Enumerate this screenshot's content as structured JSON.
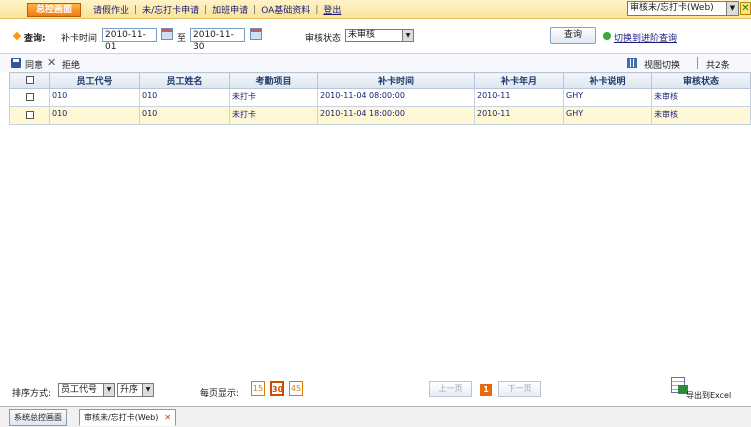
{
  "topbar": {
    "home_label": "总控画面",
    "menu": [
      "请假作业",
      "未/忘打卡申请",
      "加班申请",
      "OA基础资料",
      "登出"
    ],
    "window_select": "审核未/忘打卡(Web)"
  },
  "query": {
    "title": "查询:",
    "time_label": "补卡时间",
    "date_from": "2010-11-01",
    "to_label": "至",
    "date_to": "2010-11-30",
    "status_label": "审核状态",
    "status_value": "未审核",
    "search_button": "查询",
    "advanced_link": "切换到进阶查询"
  },
  "toolbar": {
    "approve_label": "同意",
    "reject_label": "拒绝",
    "view_toggle_label": "视图切换",
    "total_label": "共2条"
  },
  "table": {
    "columns": [
      "员工代号",
      "员工姓名",
      "考勤项目",
      "补卡时间",
      "补卡年月",
      "补卡说明",
      "审核状态"
    ],
    "rows": [
      [
        "010",
        "010",
        "未打卡",
        "2010-11-04 08:00:00",
        "2010-11",
        "GHY",
        "未审核"
      ],
      [
        "010",
        "010",
        "未打卡",
        "2010-11-04 18:00:00",
        "2010-11",
        "GHY",
        "未审核"
      ]
    ]
  },
  "pager": {
    "sort_label": "排序方式:",
    "sort_field": "员工代号",
    "sort_order": "升序",
    "page_size_label": "每页显示:",
    "page_sizes": [
      "15",
      "30",
      "45"
    ],
    "prev_label": "上一页",
    "current_page": "1",
    "next_label": "下一页",
    "export_label": "导出到Excel"
  },
  "tabs": [
    "系统总控画面",
    "审核未/忘打卡(Web)"
  ],
  "colors": {
    "topbar_bg": "#f9e39a",
    "home_button": "#ef7d10",
    "row_highlight": "#fff8d6",
    "header_text": "#1c3b6b"
  }
}
